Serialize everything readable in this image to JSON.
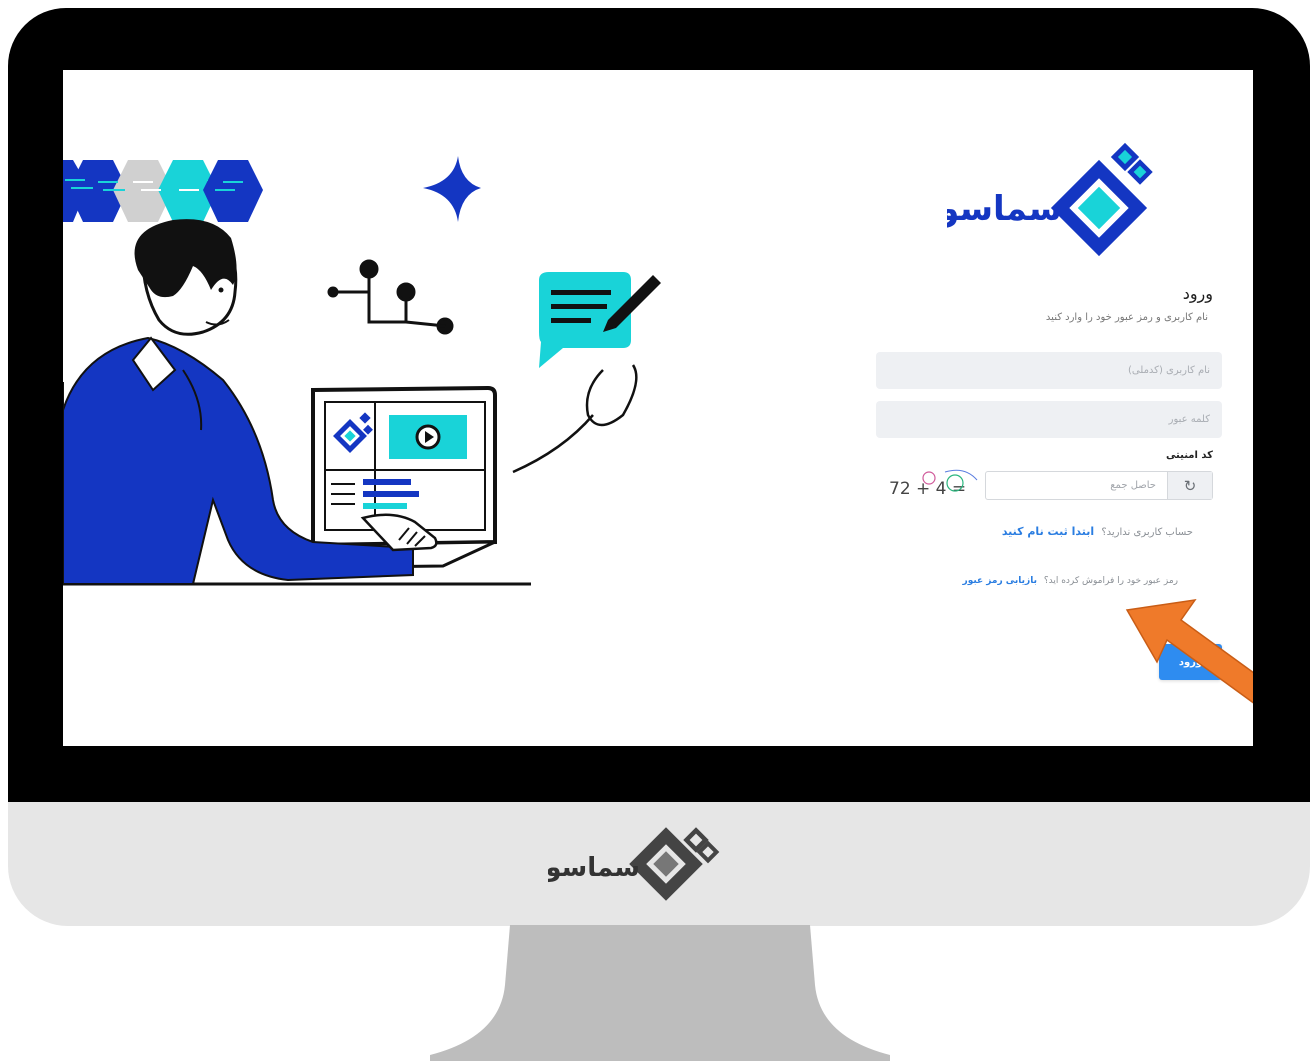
{
  "brand": {
    "name": "سماسو",
    "colors": {
      "primary_blue": "#1436c2",
      "teal": "#19d3d8",
      "accent_orange": "#ef7a2a"
    }
  },
  "login": {
    "title": "ورود",
    "subtitle": "نام کاربری و رمز عبور خود را وارد کنید",
    "username_placeholder": "نام کاربری (کدملی)",
    "password_placeholder": "کلمه عبور",
    "captcha_label": "کد امنیتی",
    "captcha_text": "72 + 4 =",
    "captcha_placeholder": "حاصل جمع",
    "register_prompt": "حساب کاربری ندارید؟",
    "register_link": "ابتدا ثبت نام کنید",
    "forgot_prompt": "رمز عبور خود را فراموش کرده اید؟",
    "forgot_link": "بازیابی رمز عبور",
    "submit_label": "ورود"
  },
  "icons": [
    "refresh-icon",
    "play-icon",
    "arrow-pointer-icon",
    "sparkle-icon",
    "chat-pen-icon"
  ]
}
